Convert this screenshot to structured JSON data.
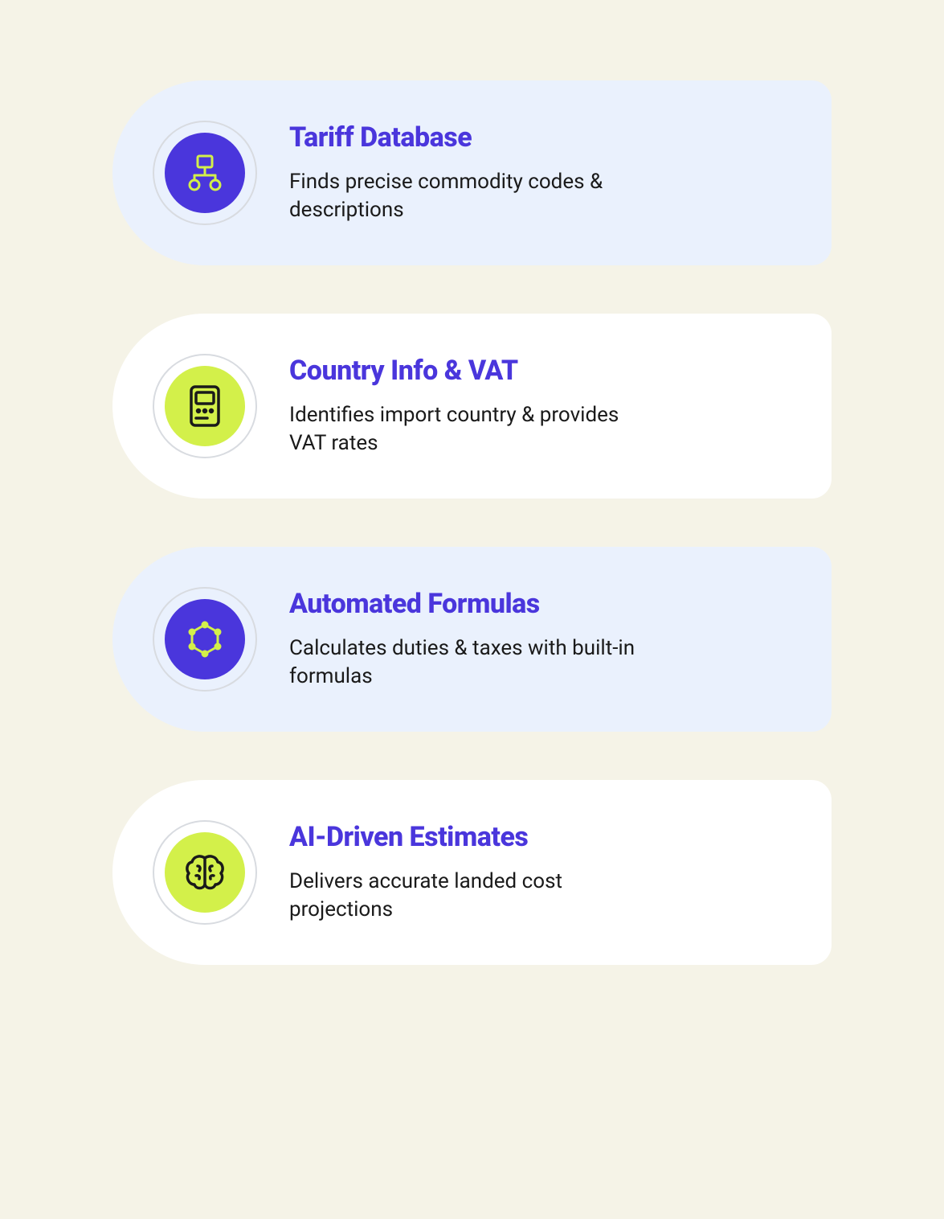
{
  "cards": [
    {
      "title": "Tariff Database",
      "description": "Finds precise commodity codes & descriptions"
    },
    {
      "title": "Country Info & VAT",
      "description": "Identifies import country & provides VAT rates"
    },
    {
      "title": "Automated Formulas",
      "description": "Calculates duties & taxes with built-in formulas"
    },
    {
      "title": "AI-Driven Estimates",
      "description": "Delivers accurate landed cost projections"
    }
  ]
}
